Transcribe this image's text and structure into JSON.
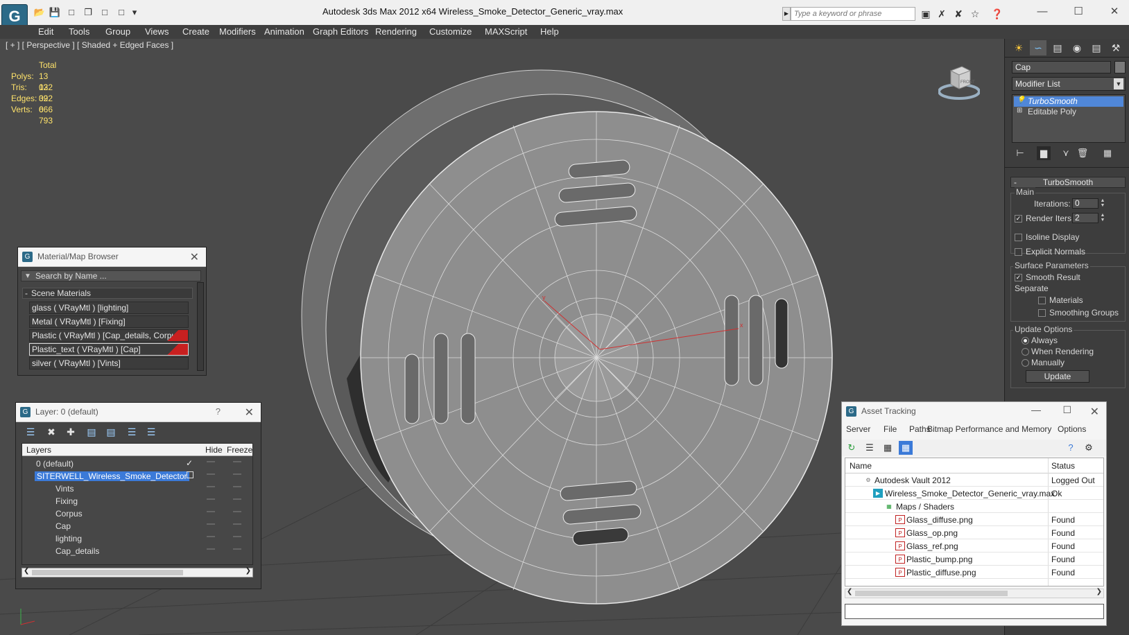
{
  "title": "Autodesk 3ds Max  2012 x64      Wireless_Smoke_Detector_Generic_vray.max",
  "search": {
    "placeholder": "Type a keyword or phrase"
  },
  "menu": [
    "Edit",
    "Tools",
    "Group",
    "Views",
    "Create",
    "Modifiers",
    "Animation",
    "Graph Editors",
    "Rendering",
    "Customize",
    "MAXScript",
    "Help"
  ],
  "viewport": {
    "label": "[ + ] [ Perspective ] [ Shaded + Edged Faces ]",
    "stats": {
      "header": "Total",
      "rows": [
        {
          "key": "Polys:",
          "value": "13 022"
        },
        {
          "key": "Tris:",
          "value": "13 022"
        },
        {
          "key": "Edges:",
          "value": "39 066"
        },
        {
          "key": "Verts:",
          "value": "6 793"
        }
      ]
    },
    "viewcube_label": "FRONT"
  },
  "command_panel": {
    "object_name": "Cap",
    "modifier_list": "Modifier List",
    "stack": [
      "TurboSmooth",
      "Editable Poly"
    ],
    "rollout_title": "TurboSmooth",
    "main_label": "Main",
    "iterations_label": "Iterations:",
    "iterations_value": "0",
    "render_iters_label": "Render Iters:",
    "render_iters_value": "2",
    "isoline": "Isoline Display",
    "explicit_normals": "Explicit Normals",
    "surface_params": "Surface Parameters",
    "smooth_result": "Smooth Result",
    "separate": "Separate",
    "materials": "Materials",
    "smoothing_groups": "Smoothing Groups",
    "update_options": "Update Options",
    "always": "Always",
    "when_rendering": "When Rendering",
    "manually": "Manually",
    "update_button": "Update"
  },
  "material_browser": {
    "title": "Material/Map Browser",
    "search_placeholder": "Search by Name ...",
    "group_header": "Scene Materials",
    "items": [
      "glass  ( VRayMtl ) [lighting]",
      "Metal  ( VRayMtl ) [Fixing]",
      "Plastic  ( VRayMtl ) [Cap_details, Corpus]",
      "Plastic_text  ( VRayMtl ) [Cap]",
      "silver  ( VRayMtl ) [Vints]"
    ]
  },
  "layer_dialog": {
    "title": "Layer: 0 (default)",
    "help": "?",
    "columns": [
      "Layers",
      "Hide",
      "Freeze"
    ],
    "rows": [
      "0 (default)",
      "SITERWELL_Wireless_Smoke_Detector",
      "Vints",
      "Fixing",
      "Corpus",
      "Cap",
      "lighting",
      "Cap_details"
    ]
  },
  "asset_tracking": {
    "title": "Asset Tracking",
    "menu": [
      "Server",
      "File",
      "Paths",
      "Bitmap Performance and Memory",
      "Options"
    ],
    "columns": [
      "Name",
      "Status"
    ],
    "rows": [
      {
        "name": "Autodesk Vault 2012",
        "status": "Logged Out"
      },
      {
        "name": "Wireless_Smoke_Detector_Generic_vray.max",
        "status": "Ok"
      },
      {
        "name": "Maps / Shaders",
        "status": ""
      },
      {
        "name": "Glass_diffuse.png",
        "status": "Found"
      },
      {
        "name": "Glass_op.png",
        "status": "Found"
      },
      {
        "name": "Glass_ref.png",
        "status": "Found"
      },
      {
        "name": "Plastic_bump.png",
        "status": "Found"
      },
      {
        "name": "Plastic_diffuse.png",
        "status": "Found"
      }
    ]
  },
  "colors": {
    "accent": "#5087d8",
    "stats": "#ffe36b",
    "selection": "#3b7ad8"
  }
}
